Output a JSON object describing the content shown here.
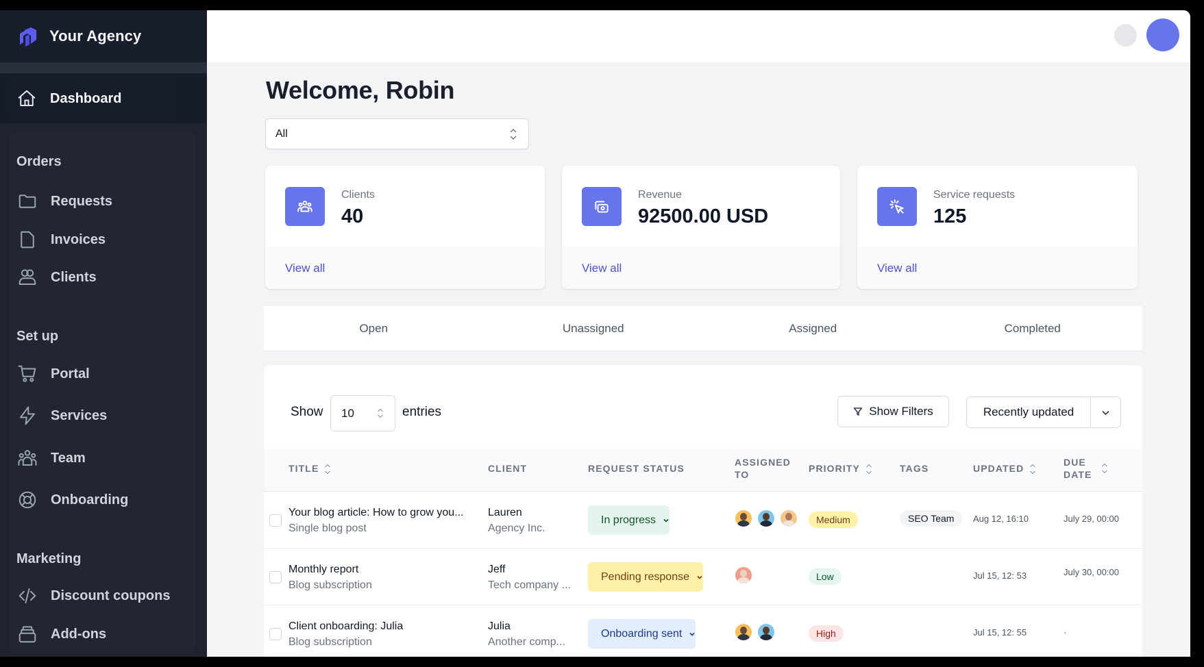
{
  "brand": {
    "name": "Your Agency",
    "logo_color": "#5b5ef0"
  },
  "sidebar": {
    "active": {
      "label": "Dashboard",
      "icon": "home-icon"
    },
    "sections": [
      {
        "title": "Orders",
        "items": [
          {
            "label": "Requests",
            "icon": "folder-icon"
          },
          {
            "label": "Invoices",
            "icon": "document-icon"
          },
          {
            "label": "Clients",
            "icon": "users-icon"
          }
        ]
      },
      {
        "title": "Set up",
        "items": [
          {
            "label": "Portal",
            "icon": "cart-icon"
          },
          {
            "label": "Services",
            "icon": "bolt-icon"
          },
          {
            "label": "Team",
            "icon": "team-icon"
          },
          {
            "label": "Onboarding",
            "icon": "lifebuoy-icon"
          }
        ]
      },
      {
        "title": "Marketing",
        "items": [
          {
            "label": "Discount coupons",
            "icon": "code-icon"
          },
          {
            "label": "Add-ons",
            "icon": "stack-icon"
          }
        ]
      }
    ]
  },
  "header": {
    "avatar_color": "#6875ea"
  },
  "main": {
    "welcome": "Welcome, Robin",
    "filter_select": {
      "value": "All"
    },
    "cards": [
      {
        "label": "Clients",
        "value": "40",
        "link": "View all",
        "icon": "user-group-icon"
      },
      {
        "label": "Revenue",
        "value": "92500.00 USD",
        "link": "View all",
        "icon": "cash-icon"
      },
      {
        "label": "Service requests",
        "value": "125",
        "link": "View all",
        "icon": "cursor-click-icon"
      }
    ],
    "tabs": [
      "Open",
      "Unassigned",
      "Assigned",
      "Completed"
    ],
    "table": {
      "show_label": "Show",
      "entries_value": "10",
      "entries_label": "entries",
      "filter_button": "Show Filters",
      "sort_value": "Recently updated",
      "columns": {
        "title": "Title",
        "client": "Client",
        "status": "Request status",
        "assigned_1": "Assigned",
        "assigned_2": "to",
        "priority": "Priority",
        "tags": "Tags",
        "updated": "Updated",
        "due_1": "Due",
        "due_2": "date"
      },
      "rows": [
        {
          "title": "Your blog article: How to grow you...",
          "subtitle": "Single blog post",
          "client": "Lauren",
          "company": "Agency Inc.",
          "status": "In progress",
          "status_bg": "#e3f5ec",
          "status_fg": "#14532d",
          "assignees": [
            {
              "bg": "#f5c15c",
              "skin": "#6b4a36",
              "shirt": "#2d3748"
            },
            {
              "bg": "#7cc6ea",
              "skin": "#5a3b2a",
              "shirt": "#1f2937"
            },
            {
              "bg": "#f2c98c",
              "skin": "#b07a5a",
              "shirt": "#f1e6df"
            }
          ],
          "priority": "Medium",
          "priority_bg": "#fdf1a8",
          "priority_fg": "#713f12",
          "tag": "SEO Team",
          "updated": "Aug 12, 16:10",
          "due": "July 29, 00:00"
        },
        {
          "title": "Monthly report",
          "subtitle": "Blog subscription",
          "client": "Jeff",
          "company": "Tech company ...",
          "status": "Pending response",
          "status_bg": "#fcf0a9",
          "status_fg": "#713f12",
          "assignees": [
            {
              "bg": "#ef9e8e",
              "skin": "#e9d2bf",
              "shirt": "#f3e3d6"
            }
          ],
          "priority": "Low",
          "priority_bg": "#e4f6ee",
          "priority_fg": "#14532d",
          "tag": "",
          "updated": "Jul 15, 12: 53",
          "due": "July 30, 00:00"
        },
        {
          "title": "Client onboarding: Julia",
          "subtitle": "Blog subscription",
          "client": "Julia",
          "company": "Another comp...",
          "status": "Onboarding sent",
          "status_bg": "#e2eefc",
          "status_fg": "#1e3a8a",
          "assignees": [
            {
              "bg": "#f5c15c",
              "skin": "#6b4a36",
              "shirt": "#2d3748"
            },
            {
              "bg": "#7cc6ea",
              "skin": "#5a3b2a",
              "shirt": "#1f2937"
            }
          ],
          "priority": "High",
          "priority_bg": "#fde5e5",
          "priority_fg": "#991b1b",
          "tag": "",
          "updated": "Jul 15, 12: 55",
          "due": "·"
        }
      ]
    }
  }
}
